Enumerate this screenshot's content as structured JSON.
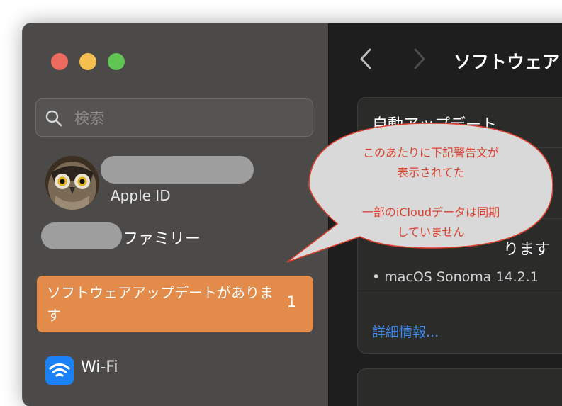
{
  "search": {
    "placeholder": "検索"
  },
  "account": {
    "apple_id_label": "Apple ID"
  },
  "family": {
    "label": "ファミリー"
  },
  "sidebar": {
    "update_item": {
      "label": "ソフトウェアアップデートがあります",
      "badge": "1"
    },
    "wifi": {
      "label": "Wi-Fi",
      "icon": "wifi-icon"
    }
  },
  "content": {
    "title": "ソフトウェア",
    "auto_update_label": "自動アップデート",
    "available_text": "ります",
    "update_list": [
      "macOS Sonoma 14.2.1"
    ],
    "details_link": "詳細情報..."
  },
  "annotation": {
    "line1": "このあたりに下記警告文が",
    "line2": "表示されてた",
    "line3": "一部のiCloudデータは同期",
    "line4": "していません"
  },
  "colors": {
    "sidebar": "#4b4a49",
    "content": "#1e1e1e",
    "accent_selected": "#e38b4a",
    "link": "#3f8df0",
    "annotation": "#d9412f"
  }
}
